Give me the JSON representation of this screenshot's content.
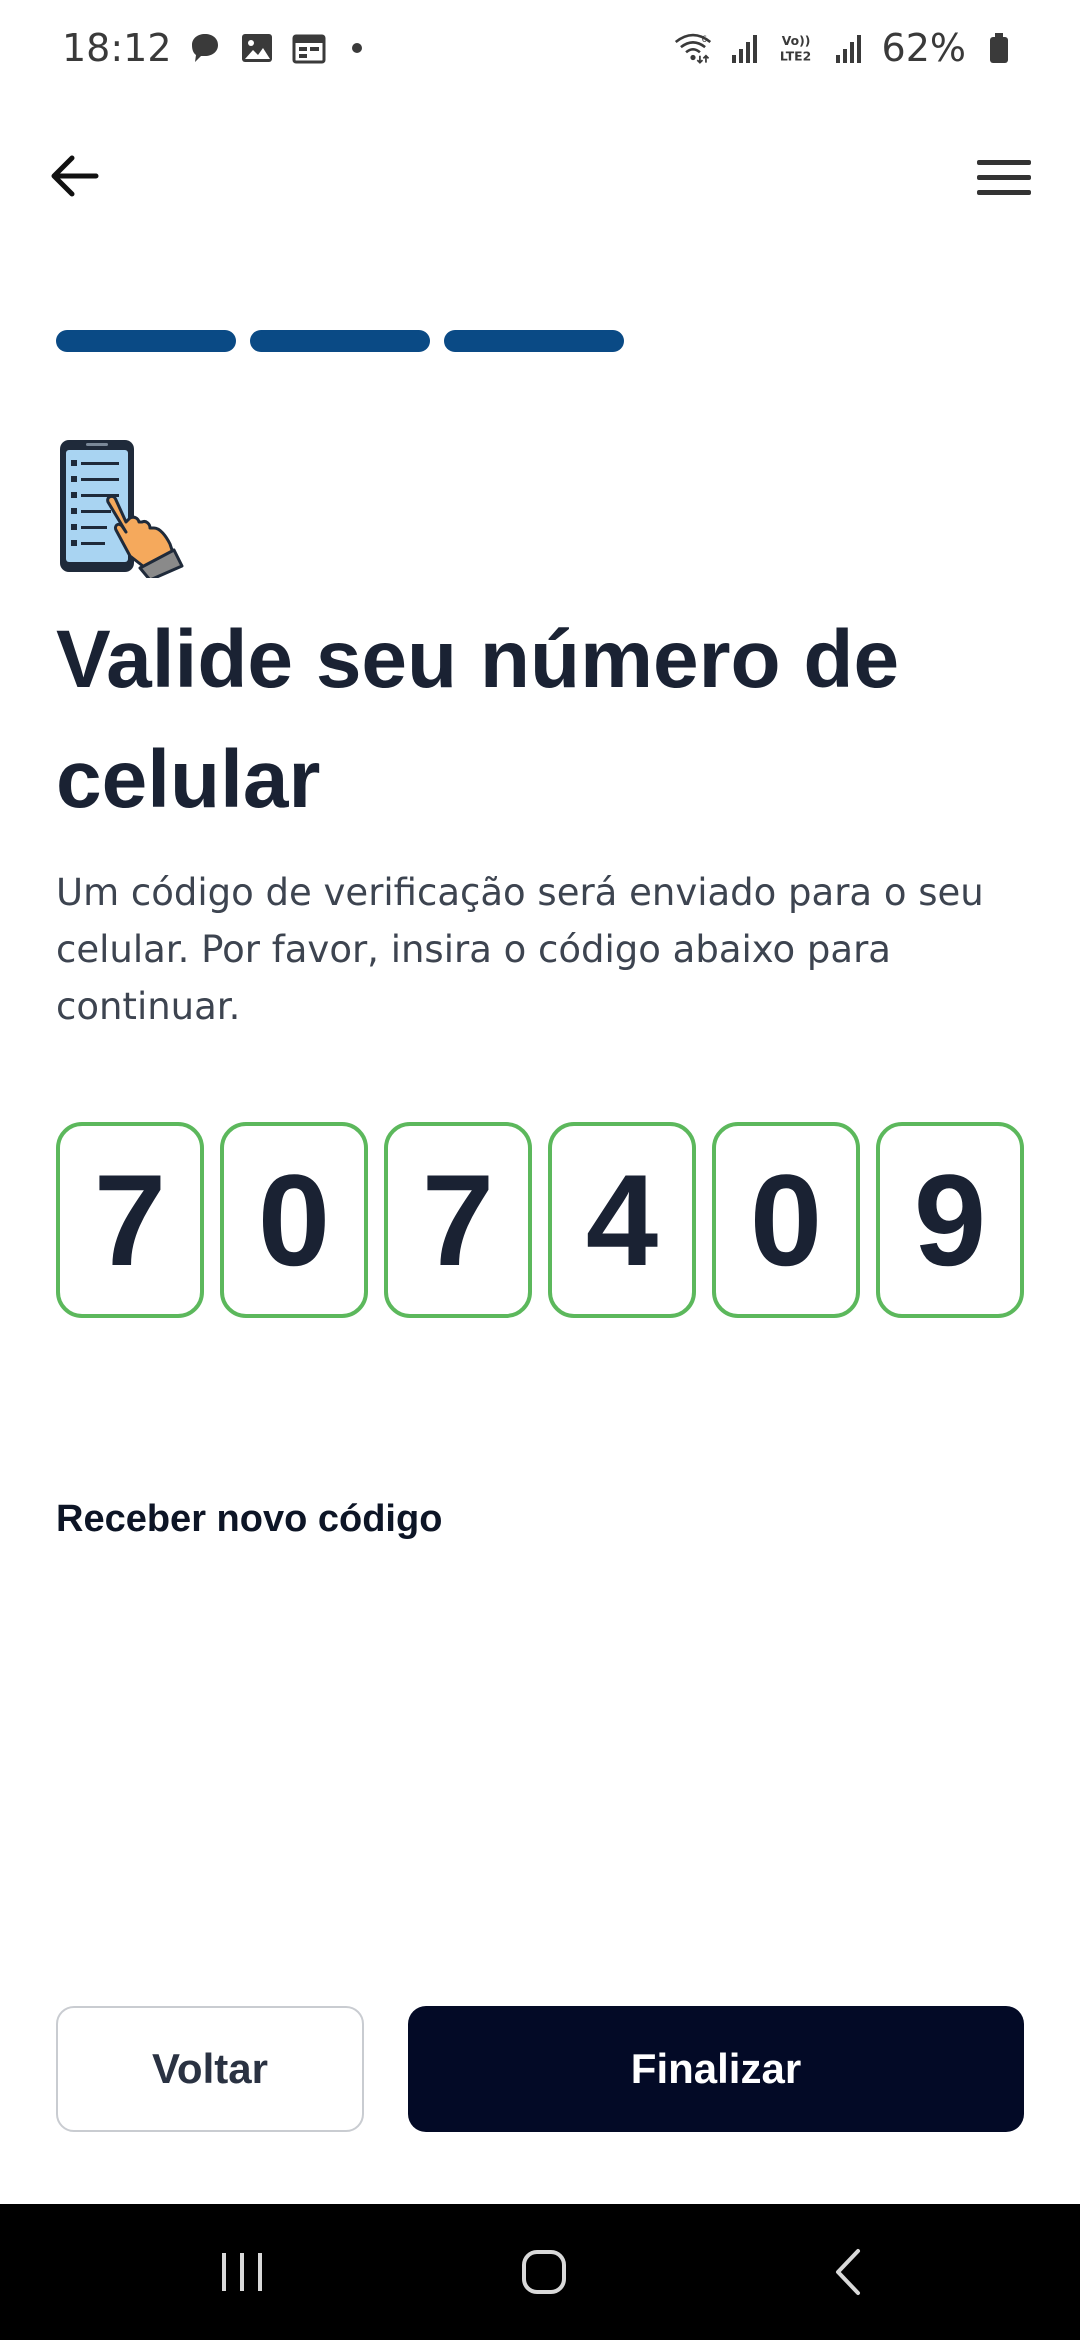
{
  "status_bar": {
    "time": "18:12",
    "battery": "62%",
    "icons": [
      "message-icon",
      "image-icon",
      "calendar-icon",
      "wifi-icon",
      "signal-icon",
      "volte-icon",
      "battery-icon"
    ]
  },
  "header": {
    "back_icon": "arrow-left-icon",
    "menu_icon": "hamburger-menu-icon"
  },
  "progress": {
    "total_steps": 3,
    "completed_steps": 3,
    "color": "#0a4a85"
  },
  "main": {
    "illustration_icon": "phone-tap-icon",
    "title": "Valide seu número de celular",
    "description": "Um código de verificação será enviado para o seu celular. Por favor, insira o código abaixo para continuar.",
    "code_digits": [
      "7",
      "0",
      "7",
      "4",
      "0",
      "9"
    ],
    "code_border_color": "#5cb85c",
    "resend_label": "Receber novo código"
  },
  "footer": {
    "back_label": "Voltar",
    "finish_label": "Finalizar",
    "finish_color": "#030a26"
  },
  "system_nav": {
    "icons": [
      "recents-icon",
      "home-icon",
      "back-nav-icon"
    ]
  }
}
